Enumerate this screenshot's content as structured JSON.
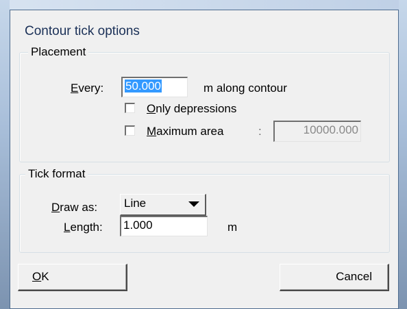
{
  "dialog": {
    "title": "Contour tick options"
  },
  "placement": {
    "legend": "Placement",
    "every": {
      "label_first": "E",
      "label_rest": "very:",
      "value": "50.000",
      "unit": "m along contour"
    },
    "only_depressions": {
      "label_first": "O",
      "label_rest": "nly depressions",
      "checked": false
    },
    "maximum_area": {
      "label_first": "M",
      "label_rest": "aximum area",
      "separator": ":",
      "value": "10000.000",
      "checked": false,
      "field_disabled": true
    }
  },
  "tick_format": {
    "legend": "Tick format",
    "draw_as": {
      "label_first": "D",
      "label_rest": "raw as:",
      "selected": "Line"
    },
    "length": {
      "label_first": "L",
      "label_rest": "ength:",
      "value": "1.000",
      "unit": "m"
    }
  },
  "buttons": {
    "ok": {
      "label_first": "O",
      "label_rest": "K"
    },
    "cancel": {
      "label": "Cancel"
    }
  },
  "icons": {
    "dropdown_arrow": "chevron-down-icon"
  }
}
